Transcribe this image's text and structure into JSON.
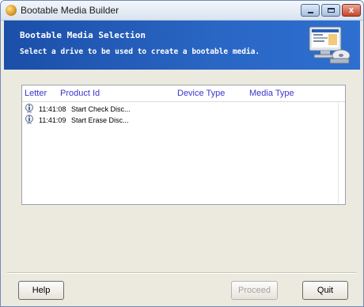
{
  "window": {
    "title": "Bootable Media Builder",
    "close_glyph": "x"
  },
  "header": {
    "title": "Bootable Media Selection",
    "subtitle": "Select a drive to be used to create a bootable media."
  },
  "list": {
    "columns": [
      "Letter",
      "Product Id",
      "Device Type",
      "Media Type"
    ],
    "rows": [
      {
        "icon": "info-icon",
        "time": "11:41:08",
        "message": "Start Check Disc..."
      },
      {
        "icon": "info-icon",
        "time": "11:41:09",
        "message": "Start Erase Disc..."
      }
    ]
  },
  "buttons": {
    "help": "Help",
    "proceed": "Proceed",
    "quit": "Quit"
  }
}
